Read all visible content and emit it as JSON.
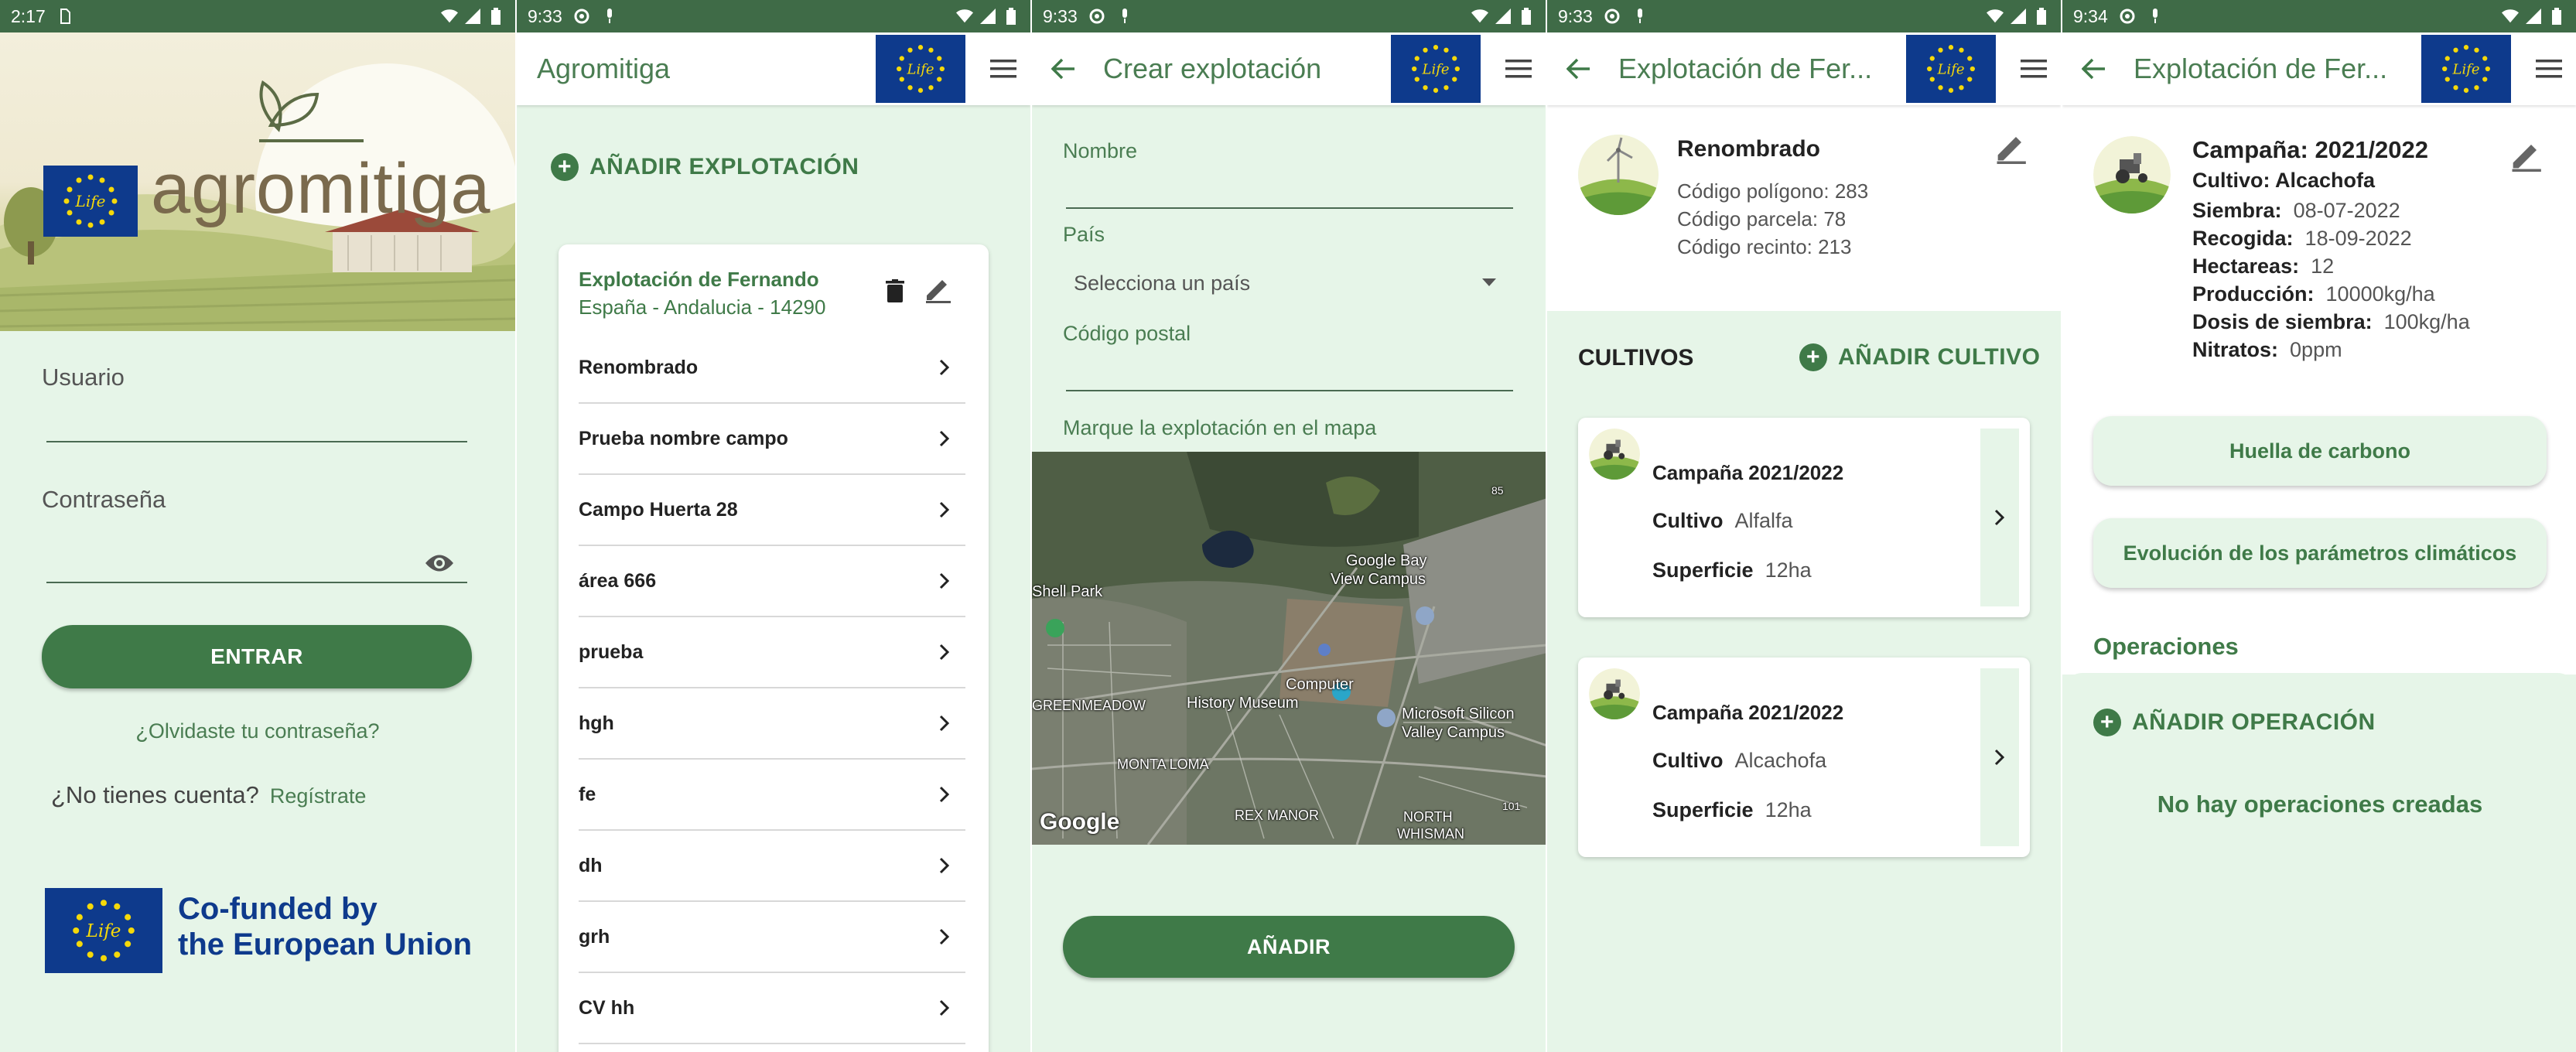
{
  "colors": {
    "primary": "#3f7a48",
    "background": "#e6f5e8",
    "statusbar": "#3f6b47",
    "eu_blue": "#0e3a8c",
    "eu_star": "#f5d90a"
  },
  "screen1": {
    "status": {
      "time": "2:17"
    },
    "logo_text": "agromitiga",
    "username_label": "Usuario",
    "username_value": "",
    "password_label": "Contraseña",
    "password_value": "",
    "login_button": "ENTRAR",
    "forgot_link": "¿Olvidaste tu contraseña?",
    "no_account": "¿No tienes cuenta?",
    "register_link": "Regístrate",
    "cofunded_line1": "Co-funded by",
    "cofunded_line2": "the European Union",
    "life_label": "Life"
  },
  "screen2": {
    "status": {
      "time": "9:33"
    },
    "title": "Agromitiga",
    "add_farm": "AÑADIR EXPLOTACIÓN",
    "farm": {
      "name": "Explotación de Fernando",
      "location": "España - Andalucia - 14290"
    },
    "fields": [
      "Renombrado",
      "Prueba nombre campo",
      "Campo Huerta 28",
      "área 666",
      "prueba",
      "hgh",
      "fe",
      "dh",
      "grh",
      "CV hh"
    ]
  },
  "screen3": {
    "status": {
      "time": "9:33"
    },
    "title": "Crear explotación",
    "name_label": "Nombre",
    "name_value": "",
    "country_label": "País",
    "country_placeholder": "Selecciona un país",
    "postal_label": "Código postal",
    "postal_value": "",
    "map_hint": "Marque la explotación en el mapa",
    "map_labels": {
      "google_bay": "Google Bay",
      "view_campus": "View Campus",
      "shell_park": "Shell Park",
      "computer": "Computer",
      "history_museum": "History Museum",
      "microsoft": "Microsoft Silicon",
      "valley_campus": "Valley Campus",
      "greenmeadow": "GREENMEADOW",
      "monta_loma": "MONTA LOMA",
      "rex_manor": "REX MANOR",
      "north": "NORTH",
      "whisman": "WHISMAN",
      "google_logo": "Google",
      "road_101": "101",
      "road_85": "85"
    },
    "add_button": "AÑADIR"
  },
  "screen4": {
    "status": {
      "time": "9:33"
    },
    "title": "Explotación de Fer...",
    "field_name": "Renombrado",
    "poligono": "Código polígono: 283",
    "parcela": "Código parcela: 78",
    "recinto": "Código recinto:  213",
    "section_title": "CULTIVOS",
    "add_crop": "AÑADIR CULTIVO",
    "crops": [
      {
        "campaign": "Campaña 2021/2022",
        "crop_label": "Cultivo",
        "crop_value": "Alfalfa",
        "area_label": "Superficie",
        "area_value": "12ha"
      },
      {
        "campaign": "Campaña 2021/2022",
        "crop_label": "Cultivo",
        "crop_value": "Alcachofa",
        "area_label": "Superficie",
        "area_value": "12ha"
      }
    ]
  },
  "screen5": {
    "status": {
      "time": "9:34"
    },
    "title": "Explotación de Fer...",
    "campaign": "Campaña: 2021/2022",
    "crop": "Cultivo: Alcachofa",
    "details": [
      {
        "label": "Siembra:",
        "value": "08-07-2022"
      },
      {
        "label": "Recogida:",
        "value": "18-09-2022"
      },
      {
        "label": "Hectareas:",
        "value": "12"
      },
      {
        "label": "Producción:",
        "value": "10000kg/ha"
      },
      {
        "label": "Dosis de siembra:",
        "value": "100kg/ha"
      },
      {
        "label": "Nitratos:",
        "value": "0ppm"
      }
    ],
    "btn_carbon": "Huella de carbono",
    "btn_climate": "Evolución de los parámetros climáticos",
    "operations_title": "Operaciones",
    "add_operation": "AÑADIR OPERACIÓN",
    "no_operations": "No hay operaciones creadas"
  }
}
